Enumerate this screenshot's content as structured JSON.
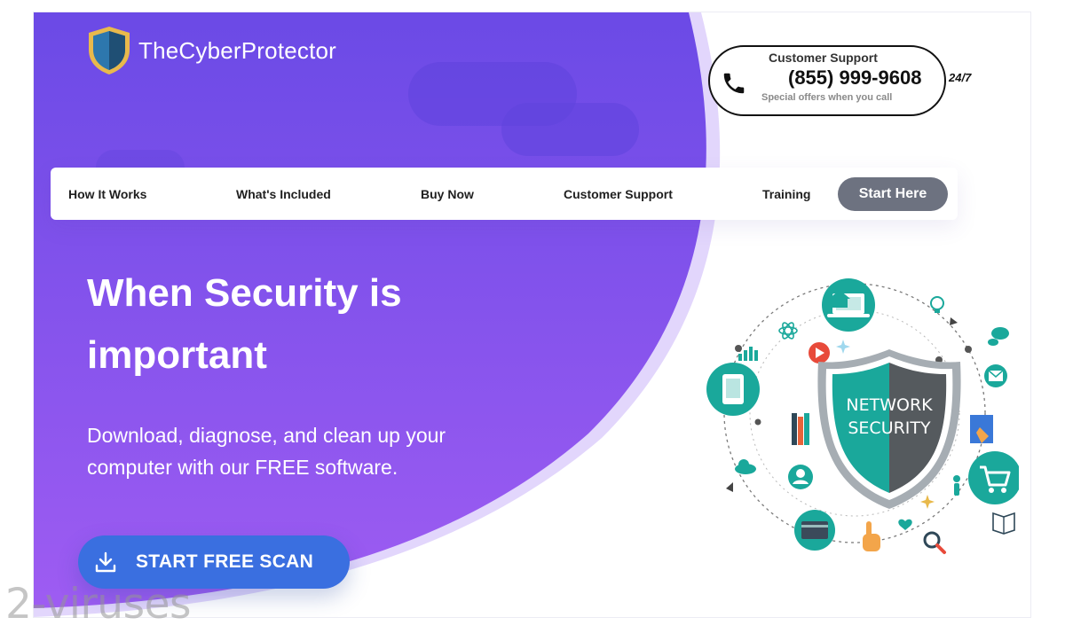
{
  "brand": {
    "name": "TheCyberProtector"
  },
  "support": {
    "title": "Customer Support",
    "number": "(855) 999-9608",
    "offer": "Special offers when you call",
    "hours": "24/7"
  },
  "nav": {
    "items": [
      {
        "label": "How It Works"
      },
      {
        "label": "What's Included"
      },
      {
        "label": "Buy Now"
      },
      {
        "label": "Customer Support"
      },
      {
        "label": "Training"
      }
    ],
    "cta": "Start Here"
  },
  "hero": {
    "title_line1": "When Security is",
    "title_line2": "important",
    "subtitle_line1": "Download, diagnose, and clean up your",
    "subtitle_line2": "computer with our FREE software.",
    "scan_button": "START FREE SCAN"
  },
  "illustration": {
    "shield_line1": "NETWORK",
    "shield_line2": "SECURITY"
  },
  "watermark": "2-viruses",
  "colors": {
    "accent_purple": "#7a45e8",
    "teal": "#1aa89b",
    "scan_blue": "#3a6fe0",
    "nav_cta_gray": "#6d7280"
  }
}
